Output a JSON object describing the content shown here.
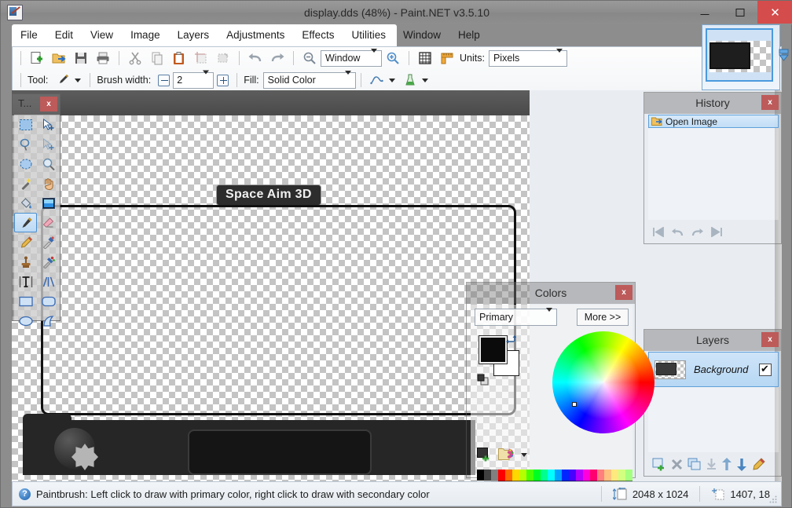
{
  "window": {
    "title": "display.dds (48%) - Paint.NET v3.5.10",
    "app_icon": "paintnet-icon",
    "minimize_label": "–",
    "maximize_label": "□",
    "close_label": "✕"
  },
  "menu": {
    "items": [
      {
        "label": "File"
      },
      {
        "label": "Edit"
      },
      {
        "label": "View"
      },
      {
        "label": "Image"
      },
      {
        "label": "Layers"
      },
      {
        "label": "Adjustments"
      },
      {
        "label": "Effects"
      },
      {
        "label": "Utilities"
      },
      {
        "label": "Window"
      },
      {
        "label": "Help"
      }
    ]
  },
  "toolbar": {
    "row1": {
      "icons": [
        {
          "name": "new-image-icon",
          "title": "New"
        },
        {
          "name": "open-image-icon",
          "title": "Open"
        },
        {
          "name": "save-icon",
          "title": "Save"
        },
        {
          "name": "print-icon",
          "title": "Print"
        },
        {
          "name": "cut-icon",
          "title": "Cut"
        },
        {
          "name": "copy-icon",
          "title": "Copy"
        },
        {
          "name": "paste-icon",
          "title": "Paste"
        },
        {
          "name": "crop-to-selection-icon",
          "title": "Crop to Selection"
        },
        {
          "name": "deselect-icon",
          "title": "Deselect All"
        },
        {
          "name": "undo-icon",
          "title": "Undo"
        },
        {
          "name": "redo-icon",
          "title": "Redo"
        }
      ],
      "zoom_out_icon": "zoom-out-icon",
      "zoom_value": "Window",
      "zoom_in_icon": "zoom-in-icon",
      "grid_icon": "grid-icon",
      "ruler_icon": "ruler-icon",
      "units_label": "Units:",
      "units_value": "Pixels"
    },
    "row2": {
      "tool_label": "Tool:",
      "tool_icon": "paintbrush-icon",
      "brush_width_label": "Brush width:",
      "brush_width_value": "2",
      "minus_button": "decrease-brush-width",
      "plus_button": "increase-brush-width",
      "fill_label": "Fill:",
      "fill_value": "Solid Color",
      "antialias_icon": "antialiasing-icon",
      "blend_icon": "blend-mode-icon"
    }
  },
  "thumbnails": {
    "selected_name": "display.dds-thumbnail",
    "scroll_icon": "scroll-down-icon"
  },
  "tools_window": {
    "title": "T...",
    "close_label": "x",
    "active_tool": "paintbrush",
    "tools": [
      {
        "name": "rectangle-select-tool",
        "label": "Rectangle Select"
      },
      {
        "name": "move-selected-tool",
        "label": "Move Selected Pixels"
      },
      {
        "name": "lasso-select-tool",
        "label": "Lasso Select"
      },
      {
        "name": "move-selection-tool",
        "label": "Move Selection"
      },
      {
        "name": "ellipse-select-tool",
        "label": "Ellipse Select"
      },
      {
        "name": "zoom-tool",
        "label": "Zoom"
      },
      {
        "name": "magic-wand-tool",
        "label": "Magic Wand"
      },
      {
        "name": "pan-tool",
        "label": "Pan"
      },
      {
        "name": "paint-bucket-tool",
        "label": "Paint Bucket"
      },
      {
        "name": "gradient-tool",
        "label": "Gradient"
      },
      {
        "name": "paintbrush-tool",
        "label": "Paintbrush"
      },
      {
        "name": "eraser-tool",
        "label": "Eraser"
      },
      {
        "name": "pencil-tool",
        "label": "Pencil"
      },
      {
        "name": "color-picker-tool",
        "label": "Color Picker"
      },
      {
        "name": "clone-stamp-tool",
        "label": "Clone Stamp"
      },
      {
        "name": "recolor-tool",
        "label": "Recolor"
      },
      {
        "name": "text-tool",
        "label": "Text"
      },
      {
        "name": "line-curve-tool",
        "label": "Line/Curve"
      },
      {
        "name": "rectangle-shape-tool",
        "label": "Rectangle"
      },
      {
        "name": "rounded-rectangle-tool",
        "label": "Rounded Rectangle"
      },
      {
        "name": "ellipse-shape-tool",
        "label": "Ellipse"
      },
      {
        "name": "freeform-shape-tool",
        "label": "Freeform Shape"
      }
    ]
  },
  "canvas": {
    "tooltip_text": "Space Aim 3D",
    "document_name": "display.dds"
  },
  "history": {
    "title": "History",
    "close_label": "x",
    "items": [
      {
        "label": "Open Image",
        "icon": "open-image-icon"
      }
    ],
    "footer_buttons": [
      {
        "name": "rewind-to-start-button",
        "glyph": "⏮"
      },
      {
        "name": "undo-button",
        "glyph": "↩"
      },
      {
        "name": "redo-button",
        "glyph": "↪"
      },
      {
        "name": "forward-to-end-button",
        "glyph": "⏭"
      }
    ]
  },
  "layers": {
    "title": "Layers",
    "close_label": "x",
    "items": [
      {
        "name": "Background",
        "visible": true
      }
    ],
    "footer_buttons": [
      {
        "name": "add-new-layer-button"
      },
      {
        "name": "delete-layer-button"
      },
      {
        "name": "duplicate-layer-button"
      },
      {
        "name": "merge-layer-down-button"
      },
      {
        "name": "move-layer-up-button"
      },
      {
        "name": "move-layer-down-button"
      },
      {
        "name": "layer-properties-button"
      }
    ]
  },
  "colors": {
    "title": "Colors",
    "close_label": "x",
    "mode_value": "Primary",
    "more_label": "More >>",
    "primary_color": "#0b0b0b",
    "secondary_color": "#ffffff",
    "swap_icon": "swap-colors-icon",
    "reset_icon": "reset-colors-icon",
    "add-to-palette_icon": "add-color-to-palette-icon",
    "palette_icon": "palette-chooser-icon",
    "palette_colors": [
      [
        "#000000",
        "#ffffff"
      ],
      [
        "#404040",
        "#c0c0c0"
      ],
      [
        "#808080",
        "#a0a0a0"
      ],
      [
        "#ff0000",
        "#7f0000"
      ],
      [
        "#ff6a00",
        "#7f3300"
      ],
      [
        "#ffd800",
        "#7f6a00"
      ],
      [
        "#b6ff00",
        "#5b7f00"
      ],
      [
        "#4cff00",
        "#267f00"
      ],
      [
        "#00ff21",
        "#007f0e"
      ],
      [
        "#00ff90",
        "#007f46"
      ],
      [
        "#00ffff",
        "#007f7f"
      ],
      [
        "#00a2ff",
        "#00517f"
      ],
      [
        "#0026ff",
        "#00137f"
      ],
      [
        "#4800ff",
        "#21007f"
      ],
      [
        "#b200ff",
        "#57007f"
      ],
      [
        "#ff00dc",
        "#7f006e"
      ],
      [
        "#ff006e",
        "#7f0037"
      ],
      [
        "#ff7f7f",
        "#7f3f3f"
      ],
      [
        "#ffc17f",
        "#7f6040"
      ],
      [
        "#ffe97f",
        "#7f7340"
      ],
      [
        "#d2ff7f",
        "#697f40"
      ],
      [
        "#a5ff7f",
        "#527f40"
      ]
    ]
  },
  "statusbar": {
    "help_icon": "help-icon",
    "help_text": "Paintbrush: Left click to draw with primary color, right click to draw with secondary color",
    "image_size_icon": "image-size-icon",
    "image_size": "2048 x 1024",
    "cursor_pos_icon": "cursor-position-icon",
    "cursor_position": "1407, 18",
    "resize_grip_icon": "resize-grip-icon"
  }
}
